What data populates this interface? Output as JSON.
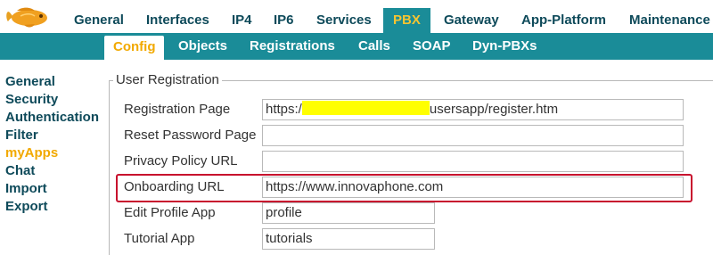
{
  "top_nav": {
    "items": [
      "General",
      "Interfaces",
      "IP4",
      "IP6",
      "Services",
      "PBX",
      "Gateway",
      "App-Platform",
      "Maintenance"
    ],
    "active": "PBX"
  },
  "sub_nav": {
    "items": [
      "Config",
      "Objects",
      "Registrations",
      "Calls",
      "SOAP",
      "Dyn-PBXs"
    ],
    "active": "Config"
  },
  "sidebar": {
    "items": [
      "General",
      "Security",
      "Authentication",
      "Filter",
      "myApps",
      "Chat",
      "Import",
      "Export"
    ],
    "active": "myApps"
  },
  "section": {
    "legend": "User Registration",
    "fields": [
      {
        "label": "Registration Page",
        "value_prefix": "https:/",
        "value_suffix": "usersapp/register.htm"
      },
      {
        "label": "Reset Password Page",
        "value": ""
      },
      {
        "label": "Privacy Policy URL",
        "value": ""
      },
      {
        "label": "Onboarding URL",
        "value": "https://www.innovaphone.com"
      },
      {
        "label": "Edit Profile App",
        "value": "profile"
      },
      {
        "label": "Tutorial App",
        "value": "tutorials"
      }
    ]
  },
  "colors": {
    "accent": "#1a8c98",
    "active_text": "#f2a900",
    "nav_text": "#0e4a5a",
    "highlight_box": "#c8102e",
    "redaction": "#ffff00"
  },
  "icons": {
    "logo": "goldfish-logo-icon"
  }
}
